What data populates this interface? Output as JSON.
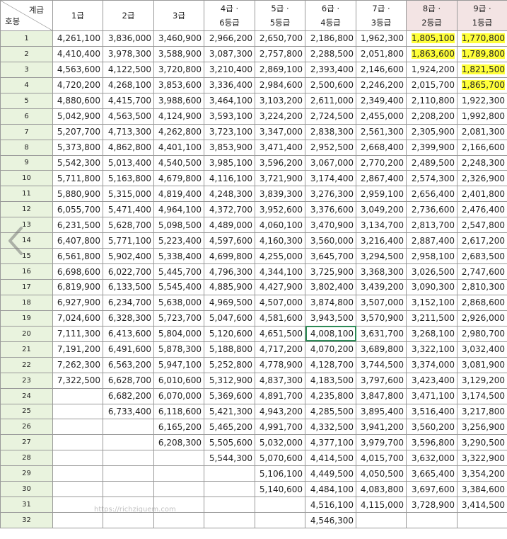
{
  "header": {
    "corner_top": "계급",
    "corner_bottom": "호봉",
    "columns": [
      {
        "line1": "1급",
        "line2": ""
      },
      {
        "line1": "2급",
        "line2": ""
      },
      {
        "line1": "3급",
        "line2": ""
      },
      {
        "line1": "4급 ·",
        "line2": "6등급"
      },
      {
        "line1": "5급 ·",
        "line2": "5등급"
      },
      {
        "line1": "6급 ·",
        "line2": "4등급"
      },
      {
        "line1": "7급 ·",
        "line2": "3등급"
      },
      {
        "line1": "8급 ·",
        "line2": "2등급"
      },
      {
        "line1": "9급 ·",
        "line2": "1등급"
      }
    ]
  },
  "rows": [
    {
      "no": "1",
      "cells": [
        "4,261,100",
        "3,836,000",
        "3,460,900",
        "2,966,200",
        "2,650,700",
        "2,186,800",
        "1,962,300",
        "1,805,100",
        "1,770,800"
      ]
    },
    {
      "no": "2",
      "cells": [
        "4,410,400",
        "3,978,300",
        "3,588,900",
        "3,087,300",
        "2,757,800",
        "2,288,500",
        "2,051,800",
        "1,863,600",
        "1,789,800"
      ]
    },
    {
      "no": "3",
      "cells": [
        "4,563,600",
        "4,122,500",
        "3,720,800",
        "3,210,400",
        "2,869,100",
        "2,393,400",
        "2,146,600",
        "1,924,200",
        "1,821,500"
      ]
    },
    {
      "no": "4",
      "cells": [
        "4,720,200",
        "4,268,100",
        "3,853,600",
        "3,336,400",
        "2,984,600",
        "2,500,600",
        "2,246,200",
        "2,015,700",
        "1,865,700"
      ]
    },
    {
      "no": "5",
      "cells": [
        "4,880,600",
        "4,415,700",
        "3,988,600",
        "3,464,100",
        "3,103,200",
        "2,611,000",
        "2,349,400",
        "2,110,800",
        "1,922,300"
      ]
    },
    {
      "no": "6",
      "cells": [
        "5,042,900",
        "4,563,500",
        "4,124,900",
        "3,593,100",
        "3,224,200",
        "2,724,500",
        "2,455,000",
        "2,208,200",
        "1,992,800"
      ]
    },
    {
      "no": "7",
      "cells": [
        "5,207,700",
        "4,713,300",
        "4,262,800",
        "3,723,100",
        "3,347,000",
        "2,838,300",
        "2,561,300",
        "2,305,900",
        "2,081,300"
      ]
    },
    {
      "no": "8",
      "cells": [
        "5,373,800",
        "4,862,800",
        "4,401,100",
        "3,853,900",
        "3,471,400",
        "2,952,500",
        "2,668,400",
        "2,399,900",
        "2,166,600"
      ]
    },
    {
      "no": "9",
      "cells": [
        "5,542,300",
        "5,013,400",
        "4,540,500",
        "3,985,100",
        "3,596,200",
        "3,067,000",
        "2,770,200",
        "2,489,500",
        "2,248,300"
      ]
    },
    {
      "no": "10",
      "cells": [
        "5,711,800",
        "5,163,800",
        "4,679,800",
        "4,116,100",
        "3,721,900",
        "3,174,400",
        "2,867,400",
        "2,574,300",
        "2,326,900"
      ]
    },
    {
      "no": "11",
      "cells": [
        "5,880,900",
        "5,315,000",
        "4,819,400",
        "4,248,300",
        "3,839,300",
        "3,276,300",
        "2,959,100",
        "2,656,400",
        "2,401,800"
      ]
    },
    {
      "no": "12",
      "cells": [
        "6,055,700",
        "5,471,400",
        "4,964,100",
        "4,372,700",
        "3,952,600",
        "3,376,600",
        "3,049,200",
        "2,736,600",
        "2,476,400"
      ]
    },
    {
      "no": "13",
      "cells": [
        "6,231,500",
        "5,628,700",
        "5,098,500",
        "4,489,000",
        "4,060,100",
        "3,470,900",
        "3,134,700",
        "2,813,700",
        "2,547,800"
      ]
    },
    {
      "no": "14",
      "cells": [
        "6,407,800",
        "5,771,100",
        "5,223,400",
        "4,597,600",
        "4,160,300",
        "3,560,000",
        "3,216,400",
        "2,887,400",
        "2,617,200"
      ]
    },
    {
      "no": "15",
      "cells": [
        "6,561,800",
        "5,902,400",
        "5,338,400",
        "4,699,800",
        "4,255,000",
        "3,645,700",
        "3,294,500",
        "2,958,100",
        "2,683,500"
      ]
    },
    {
      "no": "16",
      "cells": [
        "6,698,600",
        "6,022,700",
        "5,445,700",
        "4,796,300",
        "4,344,100",
        "3,725,900",
        "3,368,300",
        "3,026,500",
        "2,747,600"
      ]
    },
    {
      "no": "17",
      "cells": [
        "6,819,900",
        "6,133,500",
        "5,545,400",
        "4,885,900",
        "4,427,900",
        "3,802,400",
        "3,439,200",
        "3,090,300",
        "2,810,300"
      ]
    },
    {
      "no": "18",
      "cells": [
        "6,927,900",
        "6,234,700",
        "5,638,000",
        "4,969,500",
        "4,507,000",
        "3,874,800",
        "3,507,000",
        "3,152,100",
        "2,868,600"
      ]
    },
    {
      "no": "19",
      "cells": [
        "7,024,600",
        "6,328,300",
        "5,723,700",
        "5,047,600",
        "4,581,600",
        "3,943,500",
        "3,570,900",
        "3,211,500",
        "2,926,000"
      ]
    },
    {
      "no": "20",
      "cells": [
        "7,111,300",
        "6,413,600",
        "5,804,000",
        "5,120,600",
        "4,651,500",
        "4,008,100",
        "3,631,700",
        "3,268,100",
        "2,980,700"
      ]
    },
    {
      "no": "21",
      "cells": [
        "7,191,200",
        "6,491,600",
        "5,878,300",
        "5,188,800",
        "4,717,200",
        "4,070,200",
        "3,689,800",
        "3,322,100",
        "3,032,400"
      ]
    },
    {
      "no": "22",
      "cells": [
        "7,262,300",
        "6,563,200",
        "5,947,100",
        "5,252,800",
        "4,778,900",
        "4,128,700",
        "3,744,500",
        "3,374,000",
        "3,081,900"
      ]
    },
    {
      "no": "23",
      "cells": [
        "7,322,500",
        "6,628,700",
        "6,010,600",
        "5,312,900",
        "4,837,300",
        "4,183,500",
        "3,797,600",
        "3,423,400",
        "3,129,200"
      ]
    },
    {
      "no": "24",
      "cells": [
        "",
        "6,682,200",
        "6,070,000",
        "5,369,600",
        "4,891,700",
        "4,235,800",
        "3,847,800",
        "3,471,100",
        "3,174,500"
      ]
    },
    {
      "no": "25",
      "cells": [
        "",
        "6,733,400",
        "6,118,600",
        "5,421,300",
        "4,943,200",
        "4,285,500",
        "3,895,400",
        "3,516,400",
        "3,217,800"
      ]
    },
    {
      "no": "26",
      "cells": [
        "",
        "",
        "6,165,200",
        "5,465,200",
        "4,991,700",
        "4,332,500",
        "3,941,200",
        "3,560,200",
        "3,256,900"
      ]
    },
    {
      "no": "27",
      "cells": [
        "",
        "",
        "6,208,300",
        "5,505,600",
        "5,032,000",
        "4,377,100",
        "3,979,700",
        "3,596,800",
        "3,290,500"
      ]
    },
    {
      "no": "28",
      "cells": [
        "",
        "",
        "",
        "5,544,300",
        "5,070,600",
        "4,414,500",
        "4,015,700",
        "3,632,000",
        "3,322,900"
      ]
    },
    {
      "no": "29",
      "cells": [
        "",
        "",
        "",
        "",
        "5,106,100",
        "4,449,500",
        "4,050,500",
        "3,665,400",
        "3,354,200"
      ]
    },
    {
      "no": "30",
      "cells": [
        "",
        "",
        "",
        "",
        "5,140,600",
        "4,484,100",
        "4,083,800",
        "3,697,600",
        "3,384,600"
      ]
    },
    {
      "no": "31",
      "cells": [
        "",
        "",
        "",
        "",
        "",
        "4,516,100",
        "4,115,000",
        "3,728,900",
        "3,414,500"
      ]
    },
    {
      "no": "32",
      "cells": [
        "",
        "",
        "",
        "",
        "",
        "4,546,300",
        "",
        "",
        ""
      ]
    }
  ],
  "highlights": [
    [
      0,
      7
    ],
    [
      0,
      8
    ],
    [
      1,
      7
    ],
    [
      1,
      8
    ],
    [
      2,
      8
    ],
    [
      3,
      8
    ]
  ],
  "selected_cell": [
    19,
    5
  ],
  "watermark": "https://richziguem.com",
  "colors": {
    "highlight": "#ffff3a",
    "row_header_bg": "#e9f3de",
    "header_highlight_bg": "#f3e4e4",
    "selection_border": "#2e8b57"
  }
}
